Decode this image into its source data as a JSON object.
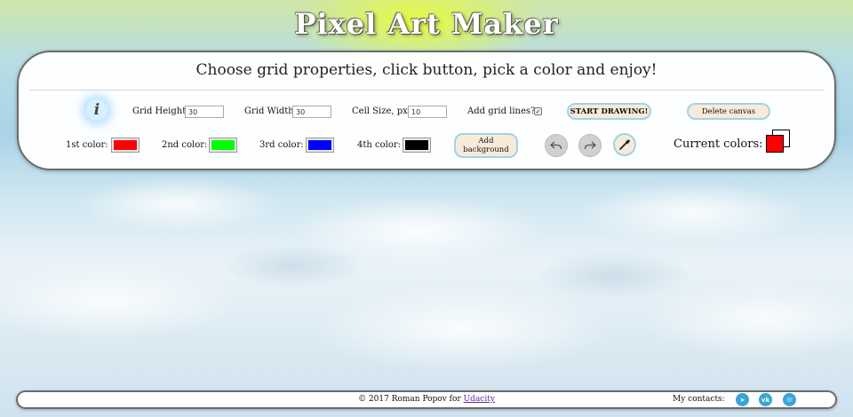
{
  "app": {
    "title": "Pixel Art Maker"
  },
  "panel": {
    "subtitle": "Choose grid properties, click button, pick a color and enjoy!",
    "info_icon": {
      "icon": "info-icon",
      "glyph": "i"
    },
    "grid_height": {
      "label": "Grid Height:",
      "value": "30"
    },
    "grid_width": {
      "label": "Grid Width:",
      "value": "30"
    },
    "cell_size": {
      "label": "Cell Size, px:",
      "value": "10"
    },
    "grid_lines": {
      "label": "Add grid lines?",
      "checked": true
    },
    "start_button": "START DRAWING!",
    "delete_button": "Delete canvas",
    "colors": [
      {
        "label": "1st color:",
        "value": "#ff0000"
      },
      {
        "label": "2nd color:",
        "value": "#00ff00"
      },
      {
        "label": "3rd color:",
        "value": "#0000ff"
      },
      {
        "label": "4th color:",
        "value": "#000000"
      }
    ],
    "add_background_button": "Add background",
    "undo_icon": "undo-icon",
    "redo_icon": "redo-icon",
    "eyedropper_icon": "eyedropper-icon",
    "current_colors_label": "Current colors:",
    "current_colors": {
      "primary": "#ff0000",
      "secondary": "#ffffff"
    }
  },
  "footer": {
    "copyright_prefix": "© 2017 Roman Popov for ",
    "copyright_link": "Udacity",
    "contacts_label": "My contacts:",
    "contacts": [
      {
        "icon": "telegram-icon",
        "glyph": "➤"
      },
      {
        "icon": "vk-icon",
        "glyph": "vk"
      },
      {
        "icon": "viber-icon",
        "glyph": "☏"
      }
    ]
  }
}
